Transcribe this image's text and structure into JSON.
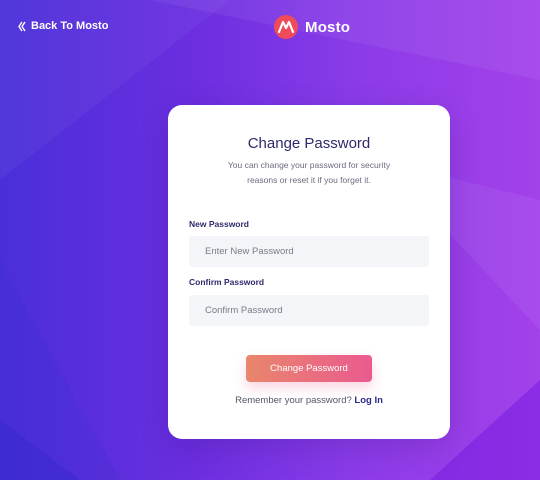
{
  "header": {
    "back_label": "Back To Mosto",
    "brand_name": "Mosto"
  },
  "card": {
    "title": "Change Password",
    "subtitle_line1": "You can change your password for security",
    "subtitle_line2": "reasons or reset it if you forget it.",
    "new_password": {
      "label": "New Password",
      "placeholder": "Enter New Password",
      "value": ""
    },
    "confirm_password": {
      "label": "Confirm Password",
      "placeholder": "Confirm Password",
      "value": ""
    },
    "submit_label": "Change Password",
    "remember_text": "Remember your password?",
    "login_label": "Log In"
  },
  "colors": {
    "background_start": "#4a2fd8",
    "background_end": "#a341ea",
    "title": "#2d2a6a",
    "button_start": "#e9866b",
    "button_end": "#ea5a8f",
    "logo": "#f04b5a"
  },
  "icons": {
    "back": "double-chevron-left-icon",
    "logo": "mosto-logo-icon"
  }
}
